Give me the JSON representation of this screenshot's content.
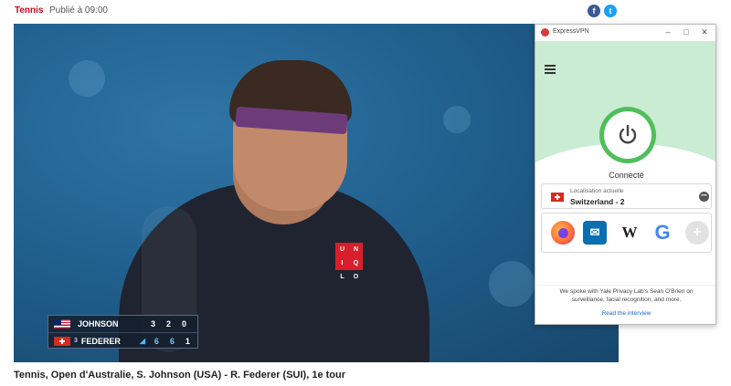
{
  "article": {
    "category": "Tennis",
    "published": "Publié à 09:00",
    "caption": "Tennis, Open d'Australie, S. Johnson (USA) - R. Federer (SUI), 1e tour"
  },
  "social": {
    "facebook_glyph": "f",
    "twitter_glyph": "t"
  },
  "scoreboard": {
    "players": [
      {
        "name": "JOHNSON",
        "seed": "",
        "serving": false,
        "sets": [
          "3",
          "2",
          "0"
        ]
      },
      {
        "name": "FEDERER",
        "seed": "3",
        "serving": true,
        "sets": [
          "6",
          "6",
          "1"
        ]
      }
    ]
  },
  "shirt_logo": [
    "U",
    "N",
    "I",
    "Q",
    "L",
    "O"
  ],
  "vpn": {
    "app_title": "ExpressVPN",
    "window_buttons": {
      "minimize": "–",
      "maximize": "□",
      "close": "✕"
    },
    "status": "Connecté",
    "location_label": "Localisation actuelle",
    "location_name": "Switzerland - 2",
    "location_more": "•••",
    "shortcuts": [
      {
        "icon": "firefox-icon"
      },
      {
        "icon": "mail-icon",
        "glyph": "✉"
      },
      {
        "icon": "wikipedia-icon",
        "glyph": "W"
      },
      {
        "icon": "google-icon",
        "glyph": "G"
      },
      {
        "icon": "add-shortcut-icon",
        "glyph": "+"
      }
    ],
    "news_text": "We spoke with Yale Privacy Lab's Sean O'Brien on surveillance, facial recognition, and more.",
    "news_link": "Read the interview",
    "colors": {
      "green": "#4fbf5c",
      "mint": "#c9ecd3",
      "brand_red": "#da3940",
      "link": "#1a66c9"
    }
  }
}
